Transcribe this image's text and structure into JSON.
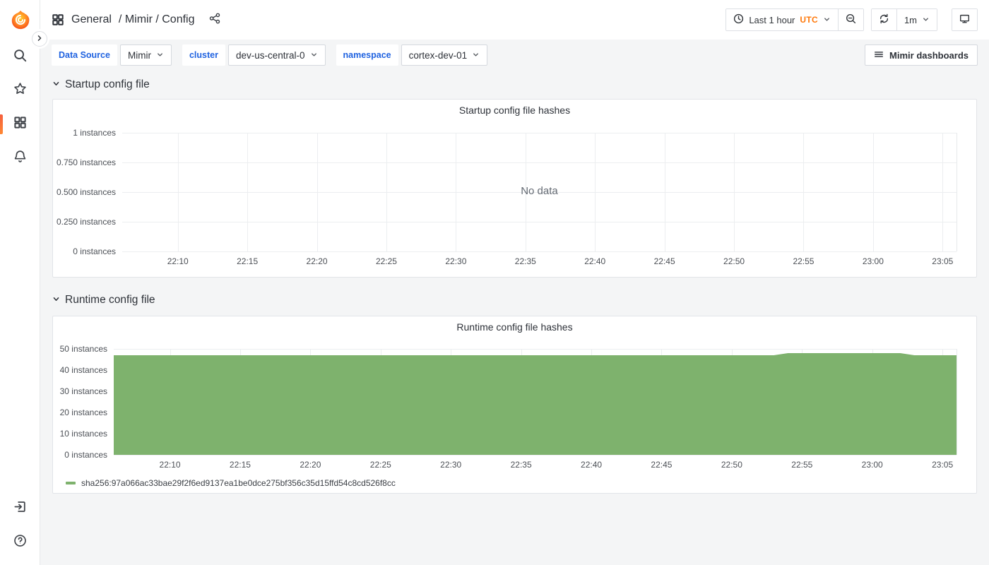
{
  "header": {
    "breadcrumb": {
      "folder": "General",
      "path": "/ Mimir / Config"
    },
    "time_picker": {
      "range_label": "Last 1 hour",
      "timezone": "UTC"
    },
    "refresh": {
      "interval": "1m"
    }
  },
  "toolbar": {
    "dashboards_button": "Mimir dashboards"
  },
  "filters": [
    {
      "label": "Data Source",
      "value": "Mimir"
    },
    {
      "label": "cluster",
      "value": "dev-us-central-0"
    },
    {
      "label": "namespace",
      "value": "cortex-dev-01"
    }
  ],
  "sections": [
    {
      "title": "Startup config file"
    },
    {
      "title": "Runtime config file"
    }
  ],
  "colors": {
    "accent_orange": "#ff780a",
    "series_green": "#7eb26d",
    "link_blue": "#1f62e0"
  },
  "chart_data": [
    {
      "type": "line",
      "title": "Startup config file hashes",
      "no_data_text": "No data",
      "ylabel_unit": "instances",
      "y_domain": [
        0,
        1
      ],
      "y_ticks": [
        "1 instances",
        "0.750 instances",
        "0.500 instances",
        "0.250 instances",
        "0 instances"
      ],
      "x_domain": [
        "22:06",
        "23:06"
      ],
      "x_ticks": [
        "22:10",
        "22:15",
        "22:20",
        "22:25",
        "22:30",
        "22:35",
        "22:40",
        "22:45",
        "22:50",
        "22:55",
        "23:00",
        "23:05"
      ],
      "grid": true,
      "legend": [],
      "series": []
    },
    {
      "type": "area",
      "title": "Runtime config file hashes",
      "ylabel_unit": "instances",
      "y_domain": [
        0,
        50
      ],
      "y_ticks": [
        "50 instances",
        "40 instances",
        "30 instances",
        "20 instances",
        "10 instances",
        "0 instances"
      ],
      "x_domain": [
        "22:06",
        "23:06"
      ],
      "x_ticks": [
        "22:10",
        "22:15",
        "22:20",
        "22:25",
        "22:30",
        "22:35",
        "22:40",
        "22:45",
        "22:50",
        "22:55",
        "23:00",
        "23:05"
      ],
      "grid": true,
      "legend_position": "bottom-left",
      "series": [
        {
          "name": "sha256:97a066ac33bae29f2f6ed9137ea1be0dce275bf356c35d15ffd54c8cd526f8cc",
          "color": "#7eb26d",
          "points": [
            [
              "22:06",
              47
            ],
            [
              "22:53",
              47
            ],
            [
              "22:54",
              48
            ],
            [
              "23:02",
              48
            ],
            [
              "23:03",
              47
            ],
            [
              "23:06",
              47
            ]
          ]
        }
      ]
    }
  ]
}
